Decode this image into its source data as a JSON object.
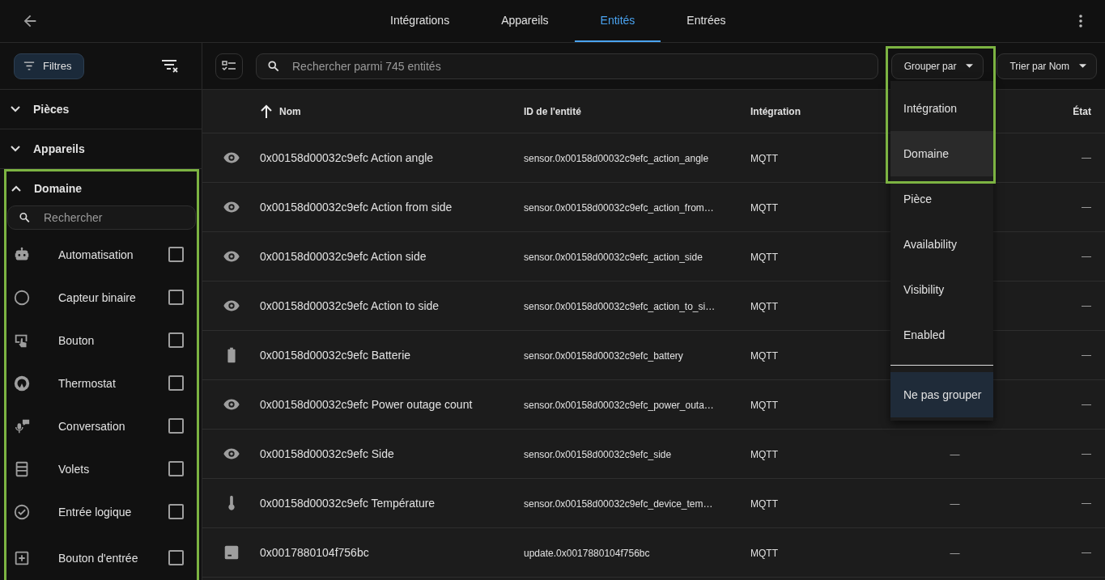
{
  "tabs": [
    {
      "label": "Intégrations",
      "selected": false
    },
    {
      "label": "Appareils",
      "selected": false
    },
    {
      "label": "Entités",
      "selected": true
    },
    {
      "label": "Entrées",
      "selected": false
    }
  ],
  "sidebar": {
    "filters_button": "Filtres",
    "sections": [
      {
        "title": "Pièces",
        "expanded": false
      },
      {
        "title": "Appareils",
        "expanded": false
      },
      {
        "title": "Domaine",
        "expanded": true,
        "highlighted": true,
        "search": {
          "placeholder": "Rechercher"
        },
        "items": [
          {
            "kind": "robot",
            "label": "Automatisation",
            "checked": false
          },
          {
            "kind": "circle",
            "label": "Capteur binaire",
            "checked": false
          },
          {
            "kind": "press",
            "label": "Bouton",
            "checked": false
          },
          {
            "kind": "gauge",
            "label": "Thermostat",
            "checked": false
          },
          {
            "kind": "mic",
            "label": "Conversation",
            "checked": false
          },
          {
            "kind": "shutter",
            "label": "Volets",
            "checked": false
          },
          {
            "kind": "check",
            "label": "Entrée logique",
            "checked": false
          },
          {
            "kind": "plus",
            "label": "Bouton d'entrée",
            "checked": false
          }
        ]
      }
    ]
  },
  "toolbar": {
    "search": {
      "placeholder": "Rechercher parmi 745 entités"
    },
    "group_button": "Grouper par",
    "sort_button": "Trier par Nom"
  },
  "table": {
    "columns": [
      {
        "label": "Nom",
        "sorted": true
      },
      {
        "label": "ID de l'entité",
        "sorted": false
      },
      {
        "label": "Intégration",
        "sorted": false
      },
      {
        "label": "État",
        "sorted": false
      }
    ],
    "rows": [
      {
        "kind": "eye",
        "name": "0x00158d00032c9efc Action angle",
        "entity_id": "sensor.0x00158d00032c9efc_action_angle",
        "integration": "MQTT",
        "state": "—"
      },
      {
        "kind": "eye",
        "name": "0x00158d00032c9efc Action from side",
        "entity_id": "sensor.0x00158d00032c9efc_action_from…",
        "integration": "MQTT",
        "state": "—"
      },
      {
        "kind": "eye",
        "name": "0x00158d00032c9efc Action side",
        "entity_id": "sensor.0x00158d00032c9efc_action_side",
        "integration": "MQTT",
        "state": "—"
      },
      {
        "kind": "eye",
        "name": "0x00158d00032c9efc Action to side",
        "entity_id": "sensor.0x00158d00032c9efc_action_to_si…",
        "integration": "MQTT",
        "state": "—"
      },
      {
        "kind": "battery",
        "name": "0x00158d00032c9efc Batterie",
        "entity_id": "sensor.0x00158d00032c9efc_battery",
        "integration": "MQTT",
        "state": "—"
      },
      {
        "kind": "eye",
        "name": "0x00158d00032c9efc Power outage count",
        "entity_id": "sensor.0x00158d00032c9efc_power_outa…",
        "integration": "MQTT",
        "state": "—"
      },
      {
        "kind": "eye",
        "name": "0x00158d00032c9efc Side",
        "entity_id": "sensor.0x00158d00032c9efc_side",
        "integration": "MQTT",
        "column_4": "—",
        "state": "—"
      },
      {
        "kind": "thermometer",
        "name": "0x00158d00032c9efc Température",
        "entity_id": "sensor.0x00158d00032c9efc_device_tem…",
        "integration": "MQTT",
        "column_4": "—",
        "state": "—"
      },
      {
        "kind": "update",
        "name": "0x0017880104f756bc",
        "entity_id": "update.0x0017880104f756bc",
        "integration": "MQTT",
        "column_4": "—",
        "state": "—"
      }
    ]
  },
  "group_menu": {
    "highlighted": true,
    "items": [
      {
        "label": "Intégration",
        "selected": false,
        "hovered": false
      },
      {
        "label": "Domaine",
        "selected": false,
        "hovered": true
      },
      {
        "label": "Pièce",
        "selected": false,
        "hovered": false
      },
      {
        "label": "Availability",
        "selected": false,
        "hovered": false
      },
      {
        "label": "Visibility",
        "selected": false,
        "hovered": false
      },
      {
        "label": "Enabled",
        "selected": false,
        "hovered": false
      },
      {
        "label": "Ne pas grouper",
        "selected": true,
        "hovered": false,
        "divider_before": true
      }
    ]
  }
}
